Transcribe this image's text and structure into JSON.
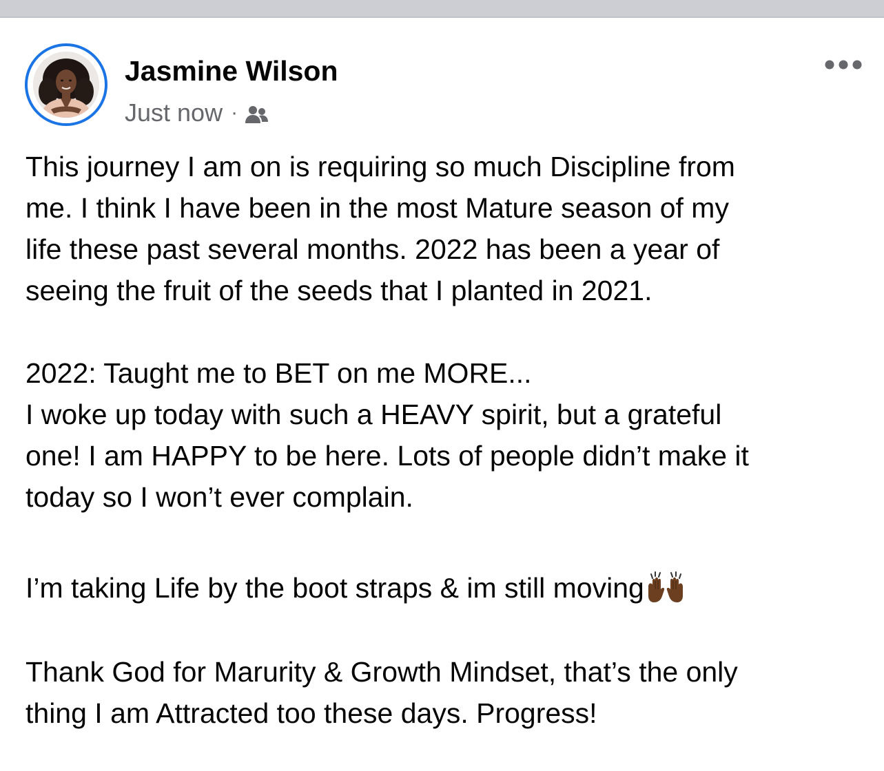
{
  "post": {
    "author": "Jasmine Wilson",
    "timestamp": "Just now",
    "separator": "·",
    "audience_icon": "friends-icon",
    "more_icon": "more-options-icon",
    "paragraphs": [
      [
        "This journey I am on is requiring so much Discipline from",
        "me. I think I have been in the most Mature season of my",
        "life these past several months. 2022 has been a year of",
        "seeing the fruit of the seeds that I planted in 2021."
      ],
      [
        "2022: Taught me to BET on me MORE...",
        "I woke up today with such a HEAVY spirit, but a grateful",
        "one! I am HAPPY to be here. Lots of people didn’t make it",
        "today so I won’t ever complain."
      ],
      [
        "I’m taking Life by the boot straps & im still moving"
      ],
      [
        "Thank God for Marurity & Growth Mindset, that’s the only",
        "thing I am Attracted too these days. Progress!"
      ]
    ],
    "emoji": "raising-hands-emoji"
  },
  "colors": {
    "accent": "#1b74e4",
    "text": "#050505",
    "secondary_text": "#65676b",
    "divider": "#ccced3"
  }
}
